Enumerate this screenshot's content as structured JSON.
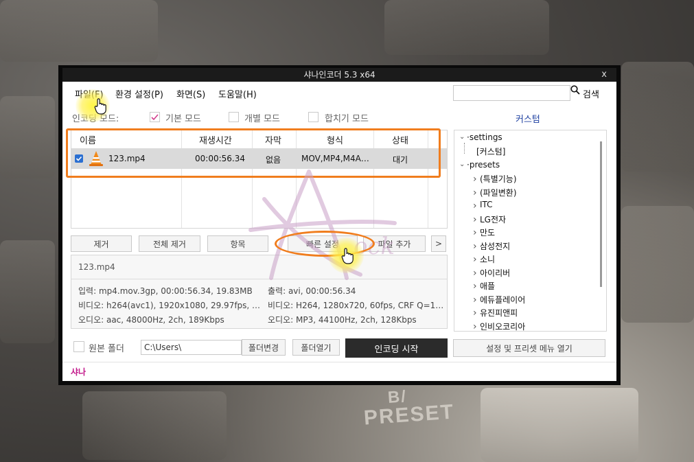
{
  "window": {
    "title": "샤나인코더  5.3  x64",
    "close_label": "x"
  },
  "menu": {
    "file": "파일(F)",
    "settings": "환경 설정(P)",
    "view": "화면(S)",
    "help": "도움말(H)"
  },
  "search": {
    "value": "",
    "button_label": "검색"
  },
  "modes": {
    "label": "인코딩 모드:",
    "basic": "기본 모드",
    "individual": "개별 모드",
    "merge": "합치기 모드",
    "basic_checked": true
  },
  "custom_link": "커스텀",
  "file_list": {
    "columns": [
      "이름",
      "재생시간",
      "자막",
      "형식",
      "상태"
    ],
    "rows": [
      {
        "checked": true,
        "name": "123.mp4",
        "duration": "00:00:56.34",
        "subtitle": "없음",
        "format": "MOV,MP4,M4A…",
        "status": "대기"
      }
    ]
  },
  "actions": {
    "remove": "제거",
    "remove_all": "전체 제거",
    "items": "항목",
    "quick_settings": "빠른 설정",
    "add_file": "파일 추가",
    "more": ">"
  },
  "info": {
    "filename": "123.mp4",
    "input": "입력: mp4.mov.3gp, 00:00:56.34, 19.83MB",
    "input_video": "비디오: h264(avc1), 1920x1080, 29.97fps, …",
    "input_audio": "오디오: aac, 48000Hz, 2ch, 189Kbps",
    "output": "출력: avi, 00:00:56.34",
    "output_video": "비디오: H264, 1280x720, 60fps, CRF Q=1…",
    "output_audio": "오디오: MP3, 44100Hz, 2ch, 128Kbps"
  },
  "tree": {
    "settings": "settings",
    "custom": "[커스텀]",
    "presets": "presets",
    "children": [
      "(특별기능)",
      "(파일변환)",
      "ITC",
      "LG전자",
      "만도",
      "삼성전지",
      "소니",
      "아이리버",
      "애플",
      "에듀플레이어",
      "유진피앤피",
      "인비오코리아"
    ]
  },
  "bottom": {
    "source_folder_label": "원본 폴더",
    "path_value": "C:\\Users\\",
    "change_folder": "폴더변경",
    "open_folder": "폴더열기",
    "start_encoding": "인코딩 시작",
    "open_menu": "설정 및 프리셋 메뉴 열기"
  },
  "status_text": "샤나",
  "colors": {
    "accent_orange": "#f07d1e",
    "link_blue": "#1d3fa0",
    "status_magenta": "#c2188a",
    "start_button_bg": "#2b2b2b"
  },
  "background": {
    "key_text_1": "B/",
    "key_text_2": "PRESET"
  }
}
